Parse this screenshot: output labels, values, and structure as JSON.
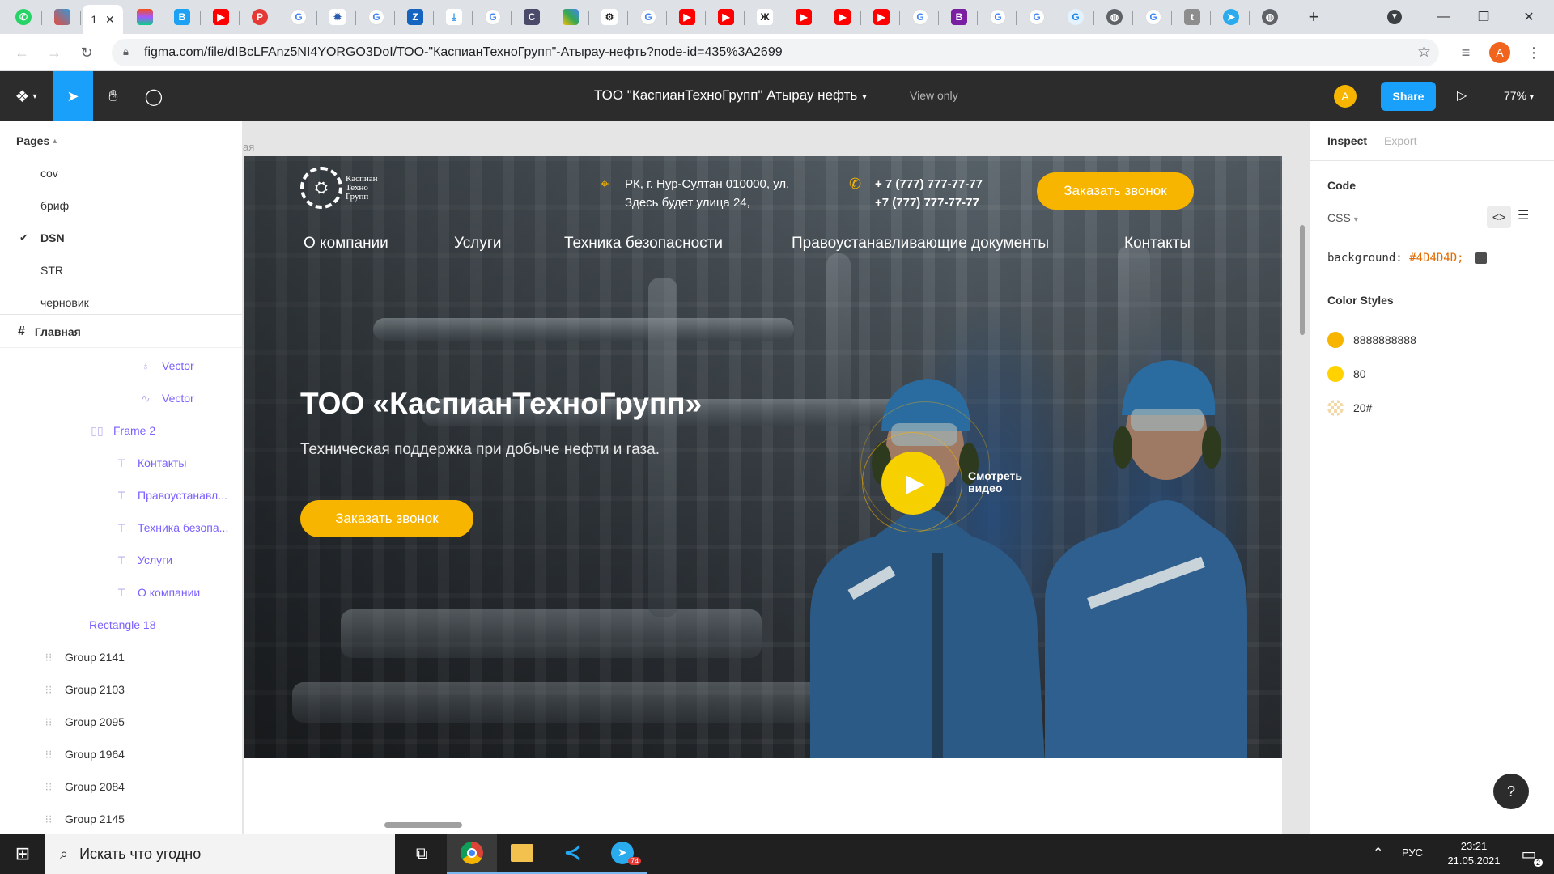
{
  "browser": {
    "active_tab_label": "1",
    "tab_favicons": [
      "whatsapp-icon",
      "app-icon",
      "figma-icon",
      "figma-icon",
      "b-icon",
      "youtube-icon",
      "p-icon",
      "google-icon",
      "gear-icon",
      "google-icon",
      "z-icon",
      "download-icon",
      "google-icon",
      "c-icon",
      "grid-icon",
      "gear-icon",
      "google-icon",
      "youtube-icon",
      "youtube-icon",
      "x-icon",
      "youtube-icon",
      "youtube-icon",
      "youtube-icon",
      "google-icon",
      "b-icon",
      "google-icon",
      "google-icon",
      "g-icon",
      "globe-icon",
      "google-icon",
      "t-icon",
      "telegram-icon",
      "globe-icon"
    ],
    "url": "figma.com/file/dIBcLFAnz5NI4YORGO3DoI/ТОО-\"КаспианТехноГрупп\"-Атырау-нефть?node-id=435%3A2699",
    "profile_initial": "A"
  },
  "figma": {
    "file_title": "ТОО \"КаспианТехноГрупп\" Атырау нефть",
    "view_mode": "View only",
    "share_label": "Share",
    "zoom": "77%",
    "user_initial": "A"
  },
  "pages": {
    "header": "Pages",
    "items": [
      {
        "label": "cov"
      },
      {
        "label": "бриф"
      },
      {
        "label": "DSN",
        "checked": true
      },
      {
        "label": "STR"
      },
      {
        "label": "черновик"
      }
    ]
  },
  "layers": {
    "root": "Главная",
    "items": [
      {
        "label": "Vector",
        "icon": "vector-icon"
      },
      {
        "label": "Vector",
        "icon": "vector-icon"
      },
      {
        "label": "Frame 2",
        "icon": "frame-icon"
      },
      {
        "label": "Контакты",
        "icon": "text-icon"
      },
      {
        "label": "Правоустанавл...",
        "icon": "text-icon"
      },
      {
        "label": "Техника безопа...",
        "icon": "text-icon"
      },
      {
        "label": "Услуги",
        "icon": "text-icon"
      },
      {
        "label": "О компании",
        "icon": "text-icon"
      },
      {
        "label": "Rectangle 18",
        "icon": "rectangle-icon"
      },
      {
        "label": "Group 2141",
        "icon": "group-icon"
      },
      {
        "label": "Group 2103",
        "icon": "group-icon"
      },
      {
        "label": "Group 2095",
        "icon": "group-icon"
      },
      {
        "label": "Group 1964",
        "icon": "group-icon"
      },
      {
        "label": "Group 2084",
        "icon": "group-icon"
      },
      {
        "label": "Group 2145",
        "icon": "group-icon"
      }
    ]
  },
  "canvas": {
    "frame_label_fragment": "ая",
    "site": {
      "logo_lines": [
        "Каспиан",
        "Техно",
        "Групп"
      ],
      "address_line1": "РК, г. Нур-Султан 010000, ул.",
      "address_line2": "Здесь будет улица 24,",
      "phone1": "+ 7 (777) 777-77-77",
      "phone2": "+7 (777) 777-77-77",
      "header_cta": "Заказать звонок",
      "nav": [
        "О компании",
        "Услуги",
        "Техника безопасности",
        "Правоустанавливающие документы",
        "Контакты"
      ],
      "hero_title": "ТОО «КаспианТехноГрупп»",
      "hero_subtitle": "Техническая поддержка при добыче нефти и газа.",
      "hero_cta": "Заказать звонок",
      "video_label_line1": "Смотреть",
      "video_label_line2": "видео"
    }
  },
  "inspect": {
    "tabs": [
      "Inspect",
      "Export"
    ],
    "code_header": "Code",
    "lang": "CSS",
    "css_property": "background:",
    "css_value": "#4D4D4D;",
    "swatch_color": "#4D4D4D",
    "color_styles_header": "Color Styles",
    "color_styles": [
      {
        "name": "8888888888",
        "color": "#f7b500"
      },
      {
        "name": "80",
        "color": "#ffd200"
      },
      {
        "name": "20#",
        "color": "#f4d9a8"
      }
    ],
    "help": "?"
  },
  "taskbar": {
    "search_placeholder": "Искать что угодно",
    "lang": "РУС",
    "time": "23:21",
    "date": "21.05.2021",
    "telegram_badge": "74",
    "notif_badge": "2"
  },
  "colors": {
    "accent_yellow": "#f7b500",
    "figma_blue": "#18a0fb",
    "figma_dark": "#2c2c2c",
    "layer_purple": "#7b61ff"
  }
}
